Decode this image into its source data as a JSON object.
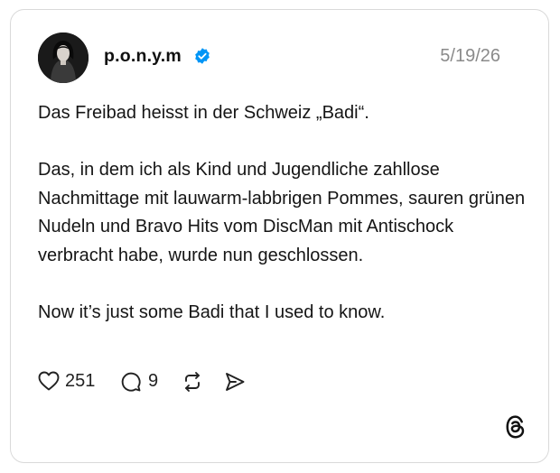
{
  "post": {
    "username": "p.o.n.y.m",
    "date": "5/19/26",
    "paragraphs": [
      "Das Freibad heisst in der Schweiz „Badi“.",
      "Das, in dem ich als Kind und Jugendliche zahllose Nachmittage mit lauwarm-labbrigen Pommes, sauren grünen Nudeln und Bravo Hits vom DiscMan mit Antischock verbracht habe, wurde nun geschlossen.",
      "Now it’s just some Badi that I used to know."
    ]
  },
  "actions": {
    "like_count": "251",
    "reply_count": "9"
  },
  "icons": {
    "verified": "verified-badge-icon",
    "like": "heart-icon",
    "reply": "reply-bubble-icon",
    "repost": "repost-icon",
    "share": "send-icon",
    "brand": "threads-logo-icon"
  },
  "colors": {
    "verified_blue": "#0095f6",
    "date_gray": "#8a8a8a",
    "border": "#d9d9d9"
  }
}
